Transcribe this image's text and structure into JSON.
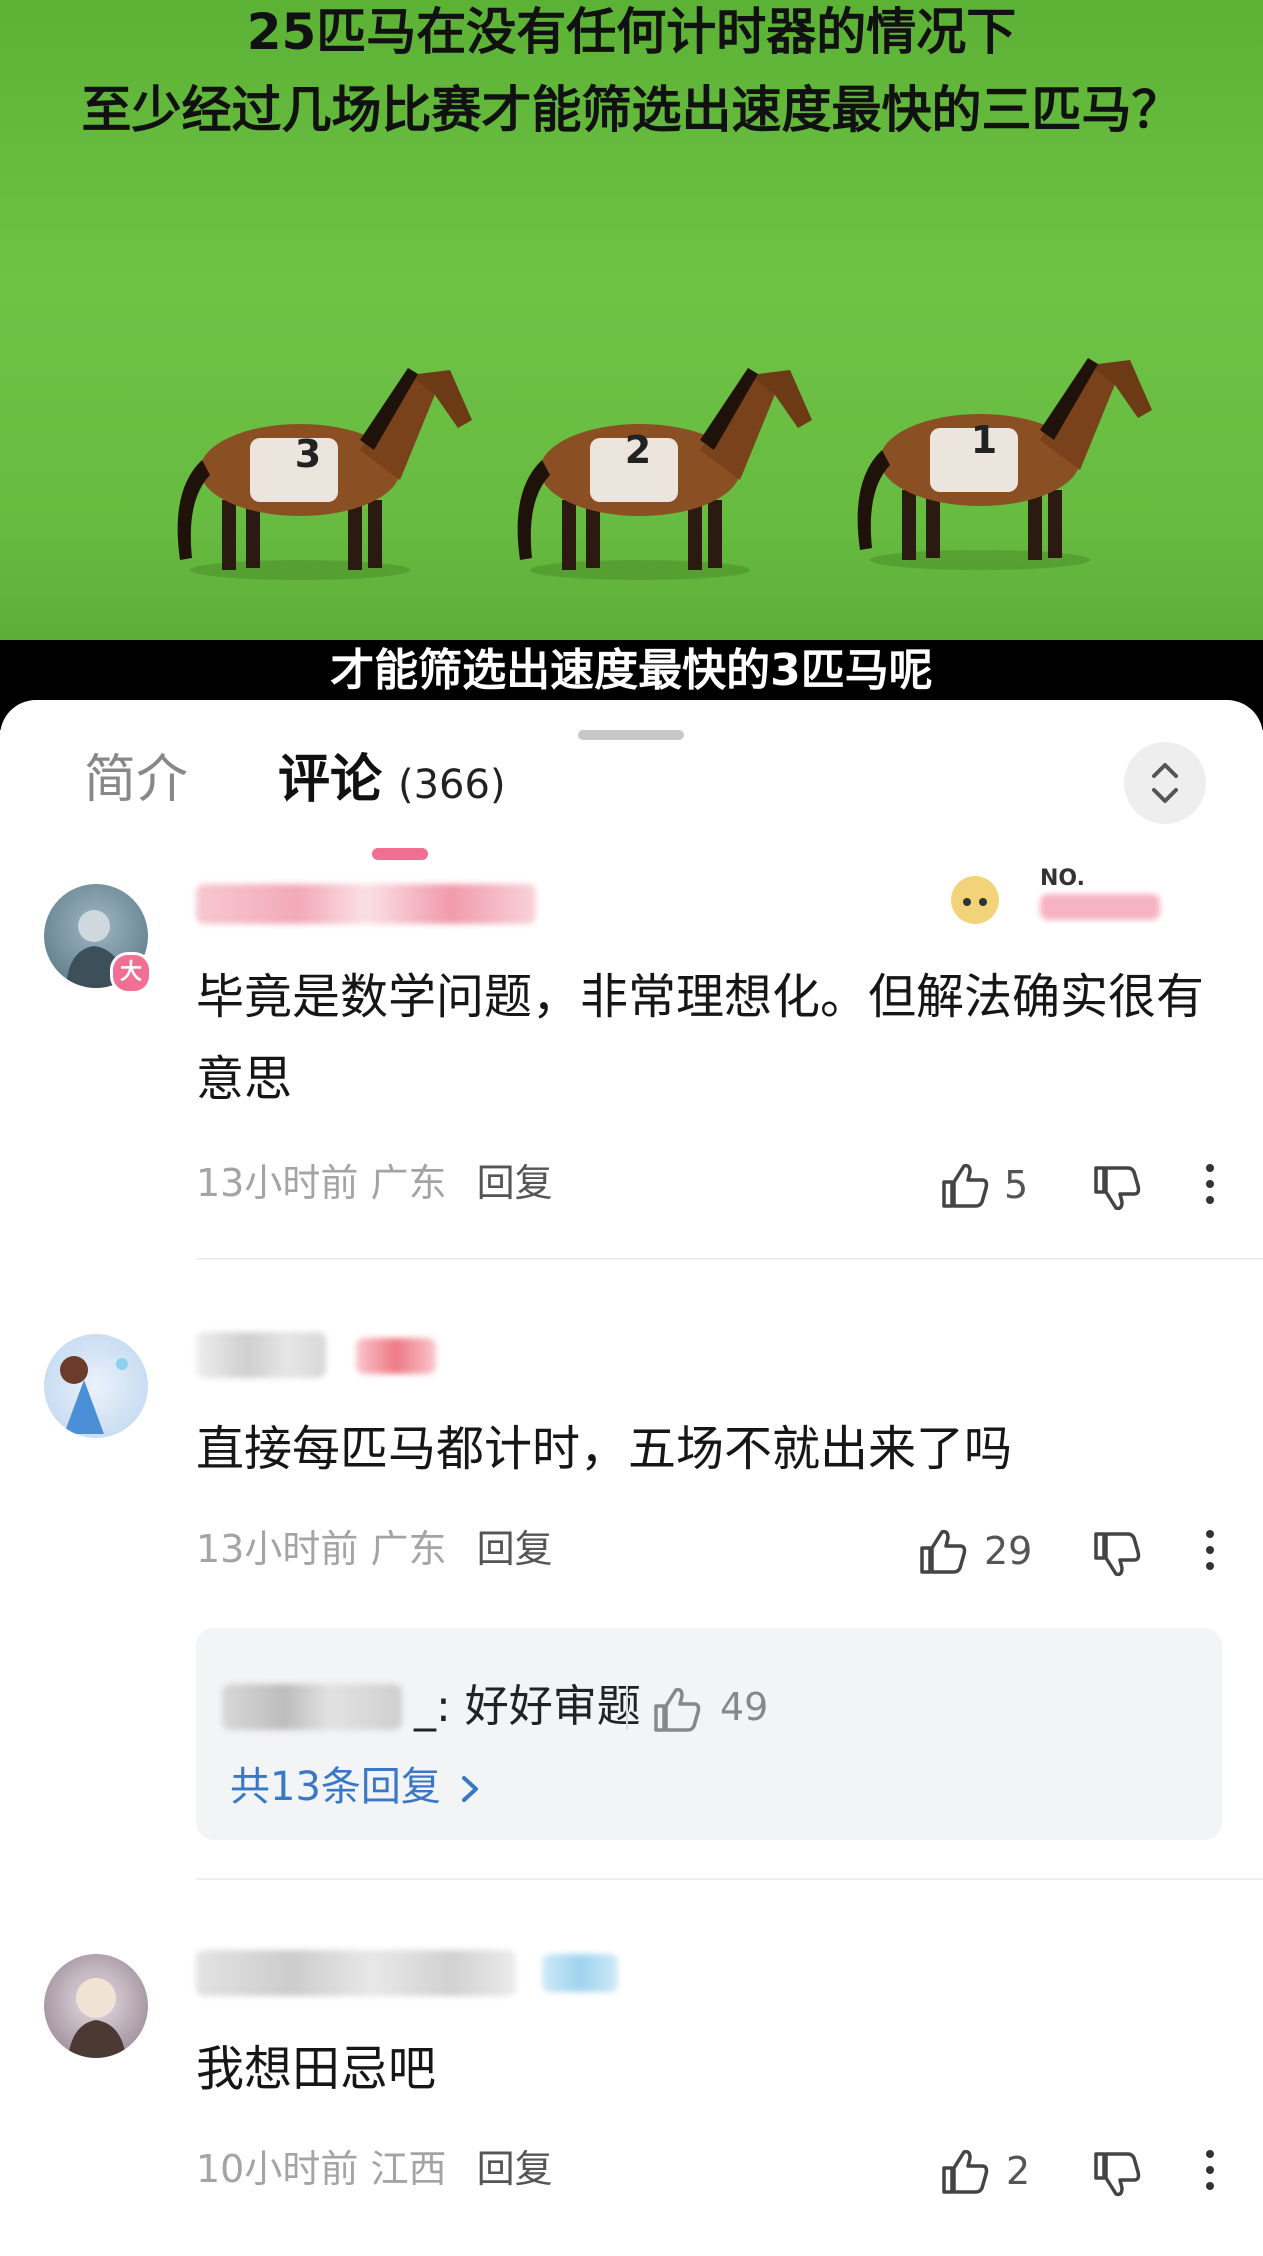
{
  "video": {
    "title_line1": "25匹马在没有任何计时器的情况下",
    "title_line2": "至少经过几场比赛才能筛选出速度最快的三匹马？",
    "horse_numbers": [
      "3",
      "2",
      "1"
    ],
    "subtitle": "才能筛选出速度最快的3匹马呢",
    "background_color": "#66bb3f"
  },
  "tabs": {
    "intro_label": "简介",
    "comments_label": "评论",
    "comments_count": "(366)",
    "active_color": "#f06f93"
  },
  "comments": [
    {
      "text": "毕竟是数学问题，非常理想化。但解法确实很有意思",
      "time": "13小时前",
      "location": "广东",
      "reply_label": "回复",
      "likes": "5",
      "badge_label": "NO.",
      "avatar_badge": "大"
    },
    {
      "text": "直接每匹马都计时，五场不就出来了吗",
      "time": "13小时前",
      "location": "广东",
      "reply_label": "回复",
      "likes": "29",
      "sub_reply": {
        "text": "_: 好好审题",
        "likes": "49",
        "view_all": "共13条回复"
      }
    },
    {
      "text": "我想田忌吧",
      "time": "10小时前",
      "location": "江西",
      "reply_label": "回复",
      "likes": "2"
    }
  ]
}
